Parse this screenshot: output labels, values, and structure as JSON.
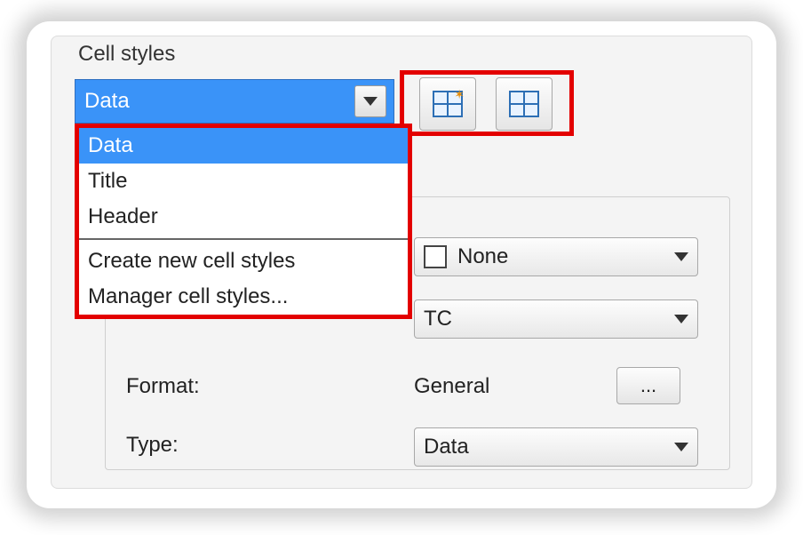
{
  "section_label": "Cell styles",
  "cell_style": {
    "selected": "Data",
    "options": [
      "Data",
      "Title",
      "Header"
    ],
    "actions": {
      "create": "Create new cell styles",
      "manage": "Manager cell styles..."
    }
  },
  "fields": {
    "none_option": "None",
    "tc_value": "TC",
    "format_label": "Format:",
    "format_value": "General",
    "type_label": "Type:",
    "type_value": "Data",
    "dots": "..."
  }
}
